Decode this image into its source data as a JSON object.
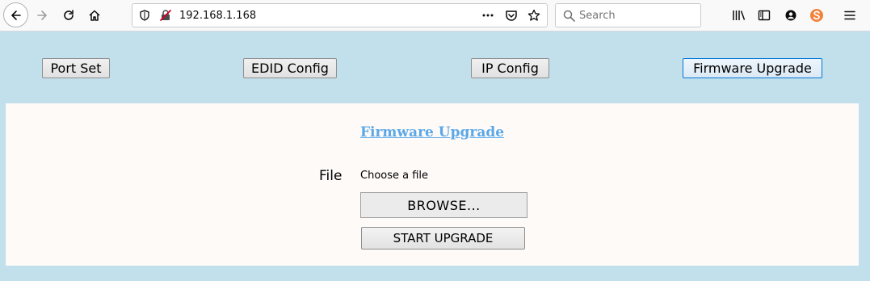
{
  "browser": {
    "url": "192.168.1.168",
    "search_placeholder": "Search"
  },
  "nav": {
    "port_set": "Port Set",
    "edid_config": "EDID Config",
    "ip_config": "IP Config",
    "firmware_upgrade": "Firmware Upgrade",
    "active": "firmware_upgrade"
  },
  "panel": {
    "title": "Firmware Upgrade",
    "file_label": "File",
    "file_status": "Choose a file",
    "browse_label": "BROWSE...",
    "start_label": "START UPGRADE"
  },
  "colors": {
    "page_background": "#c2dfec",
    "panel_background": "#fdfaf8",
    "title_link": "#5ba8e8",
    "active_border": "#0078d7"
  }
}
